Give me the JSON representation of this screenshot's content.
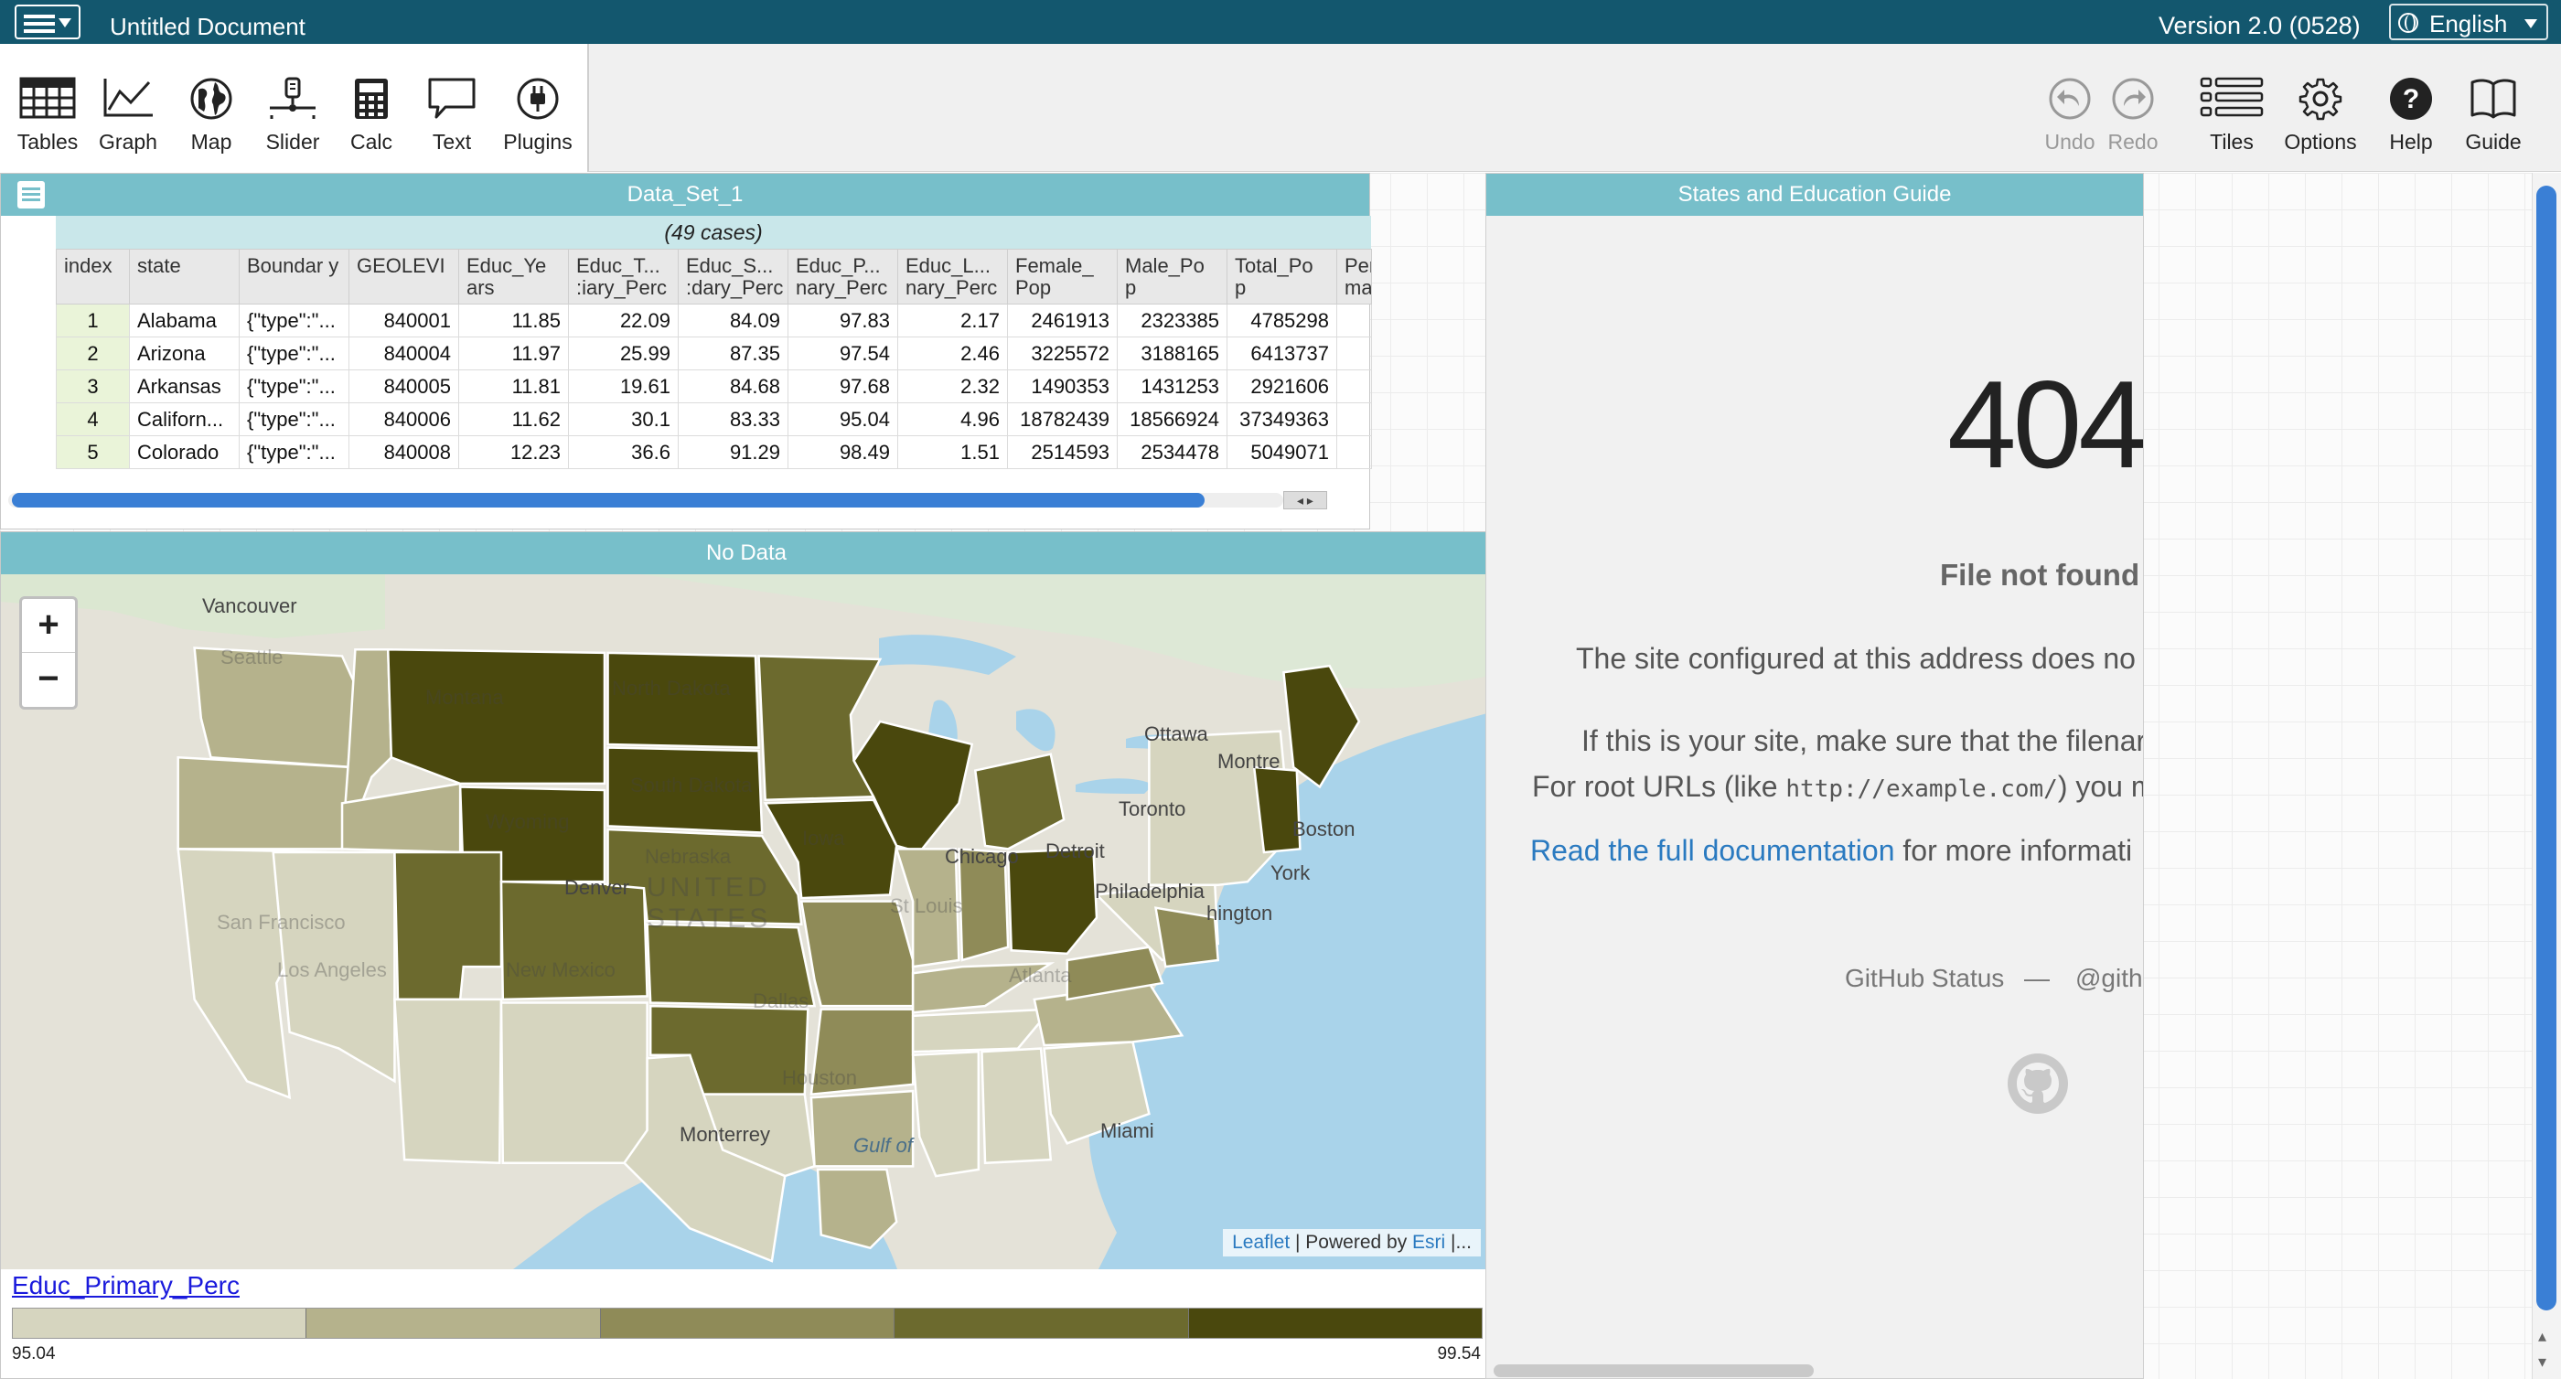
{
  "menubar": {
    "document_title": "Untitled Document",
    "version": "Version 2.0 (0528)",
    "language": "English"
  },
  "toolbar": {
    "tools": [
      "Tables",
      "Graph",
      "Map",
      "Slider",
      "Calc",
      "Text",
      "Plugins"
    ],
    "right_tools": {
      "undo": "Undo",
      "redo": "Redo",
      "tiles": "Tiles",
      "options": "Options",
      "help": "Help",
      "guide": "Guide"
    }
  },
  "table": {
    "title": "Data_Set_1",
    "cases": "(49 cases)",
    "columns": [
      "index",
      "state",
      "Boundar y",
      "GEOLEVI",
      "Educ_Ye ars",
      "Educ_T... :iary_Perc",
      "Educ_S... :dary_Perc",
      "Educ_P... nary_Perc",
      "Educ_L... nary_Perc",
      "Female_ Pop",
      "Male_Po p",
      "Total_Po p",
      "Per ma"
    ],
    "rows": [
      [
        "1",
        "Alabama",
        "{\"type\":\"...",
        "840001",
        "11.85",
        "22.09",
        "84.09",
        "97.83",
        "2.17",
        "2461913",
        "2323385",
        "4785298",
        ""
      ],
      [
        "2",
        "Arizona",
        "{\"type\":\"...",
        "840004",
        "11.97",
        "25.99",
        "87.35",
        "97.54",
        "2.46",
        "3225572",
        "3188165",
        "6413737",
        ""
      ],
      [
        "3",
        "Arkansas",
        "{\"type\":\"...",
        "840005",
        "11.81",
        "19.61",
        "84.68",
        "97.68",
        "2.32",
        "1490353",
        "1431253",
        "2921606",
        ""
      ],
      [
        "4",
        "Californ...",
        "{\"type\":\"...",
        "840006",
        "11.62",
        "30.1",
        "83.33",
        "95.04",
        "4.96",
        "18782439",
        "18566924",
        "37349363",
        ""
      ],
      [
        "5",
        "Colorado",
        "{\"type\":\"...",
        "840008",
        "12.23",
        "36.6",
        "91.29",
        "98.49",
        "1.51",
        "2514593",
        "2534478",
        "5049071",
        ""
      ]
    ]
  },
  "map": {
    "title": "No Data",
    "zoom_in": "+",
    "zoom_out": "−",
    "attribution_leaflet": "Leaflet",
    "attribution_sep": " | Powered by ",
    "attribution_esri": "Esri",
    "attribution_tail": " |...",
    "labels": {
      "vancouver": "Vancouver",
      "seattle": "Seattle",
      "montana": "Montana",
      "north_dakota": "North Dakota",
      "south_dakota": "South Dakota",
      "wyoming": "Wyoming",
      "nebraska": "Nebraska",
      "united_states": "UNITED STATES",
      "denver": "Denver",
      "san_francisco": "San Francisco",
      "los_angeles": "Los Angeles",
      "new_mexico": "New Mexico",
      "dallas": "Dallas",
      "houston": "Houston",
      "chicago": "Chicago",
      "detroit": "Detroit",
      "toronto": "Toronto",
      "ottawa": "Ottawa",
      "montreal": "Montre",
      "boston": "Boston",
      "new_york": "York",
      "philadelphia": "Philadelphia",
      "washington": "hington",
      "iowa": "Iowa",
      "atlanta": "Atlanta",
      "miami": "Miami",
      "monterrey": "Monterrey",
      "gulf": "Gulf  of",
      "stlouis": "St Louis"
    },
    "legend": {
      "attribute": "Educ_Primary_Perc",
      "min": "95.04",
      "max": "99.54",
      "colors": [
        "#d6d5bf",
        "#b5b28c",
        "#8f8b58",
        "#6c6a2e",
        "#4a480d"
      ]
    }
  },
  "guide": {
    "title": "States and Education Guide",
    "code": "404",
    "subtitle": "File not found",
    "line1": "The site configured at this address does no",
    "line2": "If this is your site, make sure that the filenar",
    "line3_a": "For root URLs (like ",
    "line3_code": "http://example.com/",
    "line3_b": ") you m",
    "link": "Read the full documentation",
    "line4_b": " for more informati",
    "status": "GitHub Status",
    "dash": "—",
    "handle": "@githu"
  }
}
